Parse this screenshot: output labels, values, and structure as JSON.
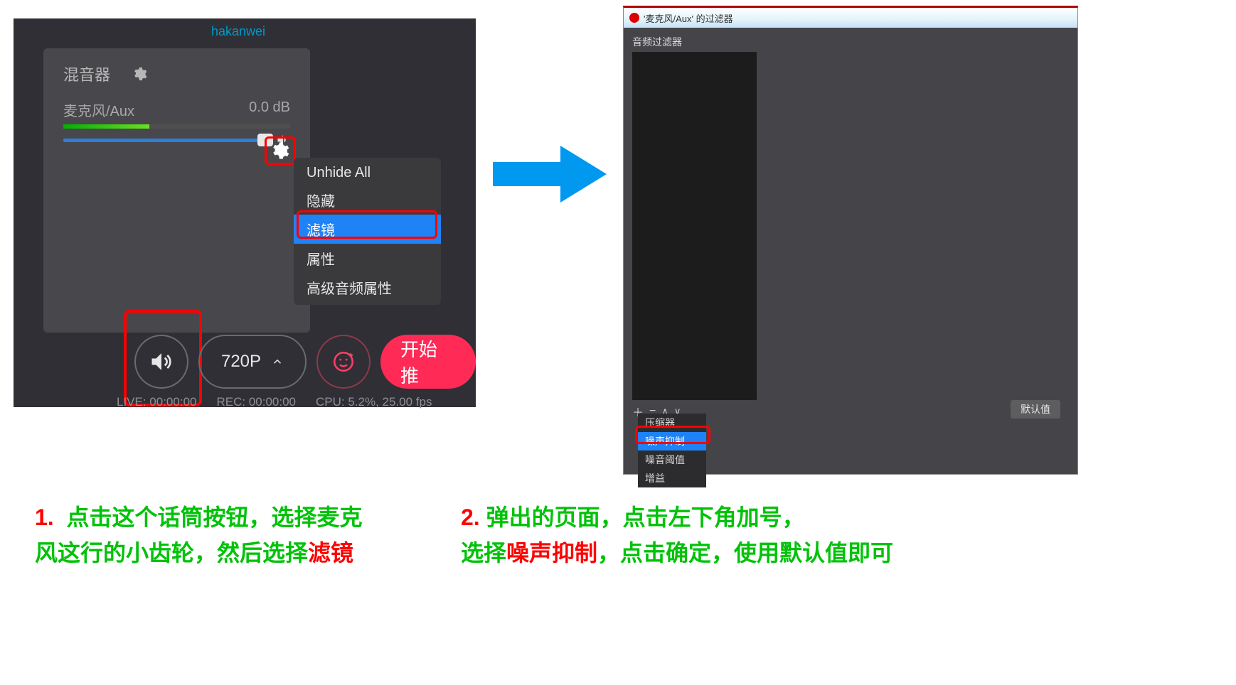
{
  "watermark": "hakanwei",
  "mixer": {
    "title": "混音器",
    "source_name": "麦克风/Aux",
    "source_db": "0.0 dB"
  },
  "context_menu": {
    "items": [
      "Unhide All",
      "隐藏",
      "滤镜",
      "属性",
      "高级音频属性"
    ],
    "selected_index": 2
  },
  "bottom": {
    "resolution": "720P",
    "start_push": "开始推",
    "live": "LIVE: 00:00:00",
    "rec": "REC: 00:00:00",
    "cpu": "CPU: 5.2%, 25.00 fps"
  },
  "dialog": {
    "title": "'麦克风/Aux' 的过滤器",
    "filters_label": "音频过滤器",
    "defaults_btn": "默认值",
    "add_menu": {
      "items": [
        "压缩器",
        "噪声抑制",
        "噪音阈值",
        "增益"
      ],
      "selected_index": 1
    }
  },
  "captions": {
    "left_num": "1.",
    "left_a": "点击这个话筒按钮，选择麦克",
    "left_b": "风这行的小齿轮，然后选择",
    "left_red": "滤镜",
    "right_num": "2.",
    "right_a": "弹出的页面，点击左下角加号，",
    "right_b1": "选择",
    "right_red": "噪声抑制",
    "right_b2": "，点击确定，使用默认值即可"
  }
}
